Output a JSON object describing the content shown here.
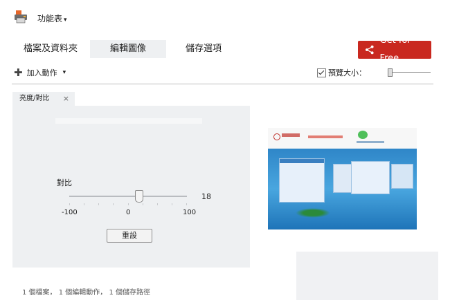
{
  "header": {
    "menu_label": "功能表",
    "menu_caret": "▾"
  },
  "tabs": [
    {
      "label": "檔案及資料夾",
      "active": false
    },
    {
      "label": "編輯圖像",
      "active": true
    },
    {
      "label": "儲存選項",
      "active": false
    }
  ],
  "share_button": {
    "label": "Get for Free",
    "color": "#c9281f"
  },
  "toolbar": {
    "add_action_label": "加入動作",
    "add_action_caret": "▾",
    "preview_size_label": "預覽大小：",
    "preview_size_checked": true
  },
  "effect_panel": {
    "tab_label": "亮度/對比",
    "close_glyph": "×",
    "slider": {
      "label": "對比",
      "value": "18",
      "min_label": "-100",
      "mid_label": "0",
      "max_label": "100",
      "min": -100,
      "max": 100,
      "current": 18
    },
    "reset_label": "重設"
  },
  "status": {
    "text": "1 個檔案， 1 個編輯動作， 1 個儲存路徑"
  },
  "icons": {
    "app": "printer-icon",
    "share": "share-icon",
    "add": "plus-icon",
    "close": "close-icon"
  }
}
